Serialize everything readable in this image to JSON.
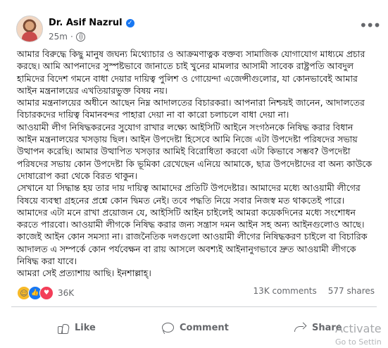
{
  "post": {
    "author": "Dr. Asif Nazrul",
    "time": "25m",
    "more_icon": "more-horizontal-icon",
    "paragraphs": [
      "আমার বিরুদ্ধে কিছু মানুষ জঘন্য মিথ্যোচার ও আক্রমণাত্নক বক্তব্য সামাজিক যোগাযোগ মাধ্যমে প্রচার করছে। আমি আপনাদের সুস্পষ্টভাবে জানাতে চাই খুনের মামলার আসামী সাবেক রাষ্ট্রপতি আবদুল হামিদের বিদেশ গমনে বাধা দেয়ার দায়িত্ব পুলিশ ও গোয়েন্দা এজেন্সীগুলোর, যা কোনভাবেই আমার আইন মন্ত্রনালয়ের এখতিয়ারভুক্ত বিষয় নয়।",
      "আমার মন্ত্রনালয়ের অধীনে আছেন নিম্ন আদালতের বিচারকরা। আপনারা নিশ্চয়ই জানেন, আদালতের বিচারকদের দায়িত্ব বিমানবন্দর পাহারা দেয়া না বা কারো চলাচলে বাধা দেয়া না।",
      "আওয়ামী লীগ নিষিদ্ধকরনের সুযোগ রাখার লক্ষ্যে আইসিটি আইনে সংগঠনকে নিষিদ্ধ করার বিধান আইন মন্ত্রনালয়ের খসড়ায় ছিল। আইন উপদেষ্টা হিসেবে আমি নিজে এটা উপদেষ্টা পরিষদের সভায় উত্থাপন করেছি। আমার উত্থাপিত খসড়ার আমিই বিরোধিতা করবো এটা কিভাবে সম্ভব? উপদেষ্টা পরিষদের সভায় কোন উপদেষ্টা কি ভূমিকা রেখেছেন এনিয়ে আমাকে, ছাত্র উপদেষ্টাদের বা অন্য কাউকে দোষারোপ করা থেকে বিরত থাকুন।",
      "সেখানে যা সিদ্ধান্ত হয় তার দায় দায়িত্ব আমাদের প্রতিটি উপদেষ্টার। আমাদের মধ্যে আওয়ামী লীগের বিষয়ে ব্যবস্থা গ্রহনের প্রশ্নে কোন দ্বিমত নেই। তবে পদ্ধতি নিয়ে সবার নিজস্ব মত থাকতেই পারে।",
      "আমাদের এটা মনে রাখা প্রয়োজন যে, আইসিটি আইন চাইলেই আমরা কয়েকদিনের মধ্যে সংশোধন করতে পারবো। আওয়ামী লীগকে নিষিদ্ধ করার জন্য সন্ত্রাস দমন আইন সহ অন্য আইনগুলোও আছে। কাজেই আইন কোন সমস্যা না।  রাজনৈতিক দলগুলো আওয়ামী লীগের নিষিদ্ধকরণ চাইলে বা বিচারিক আদালত এ সম্পর্কে কোন পর্যবেক্ষন বা রায় আসলে অবশ্যই আইনানুগভাবে দ্রুত আওয়ামী লীগকে নিষিদ্ধ করা যাবে।",
      "আমরা সেই প্রত্যাশায় আছি। ইনশাল্লাহ্।"
    ],
    "reactions_count": "36K",
    "comments_count": "13K comments",
    "shares_count": "577 shares",
    "actions": {
      "like": "Like",
      "comment": "Comment",
      "share": "Share"
    }
  },
  "watermark": {
    "title": "Activate",
    "subtitle": "Go to Settin"
  },
  "colors": {
    "facebook_blue": "#1877f2",
    "muted_text": "#65676b",
    "haha_yellow": "#f7b928",
    "love_red": "#f33e58"
  }
}
